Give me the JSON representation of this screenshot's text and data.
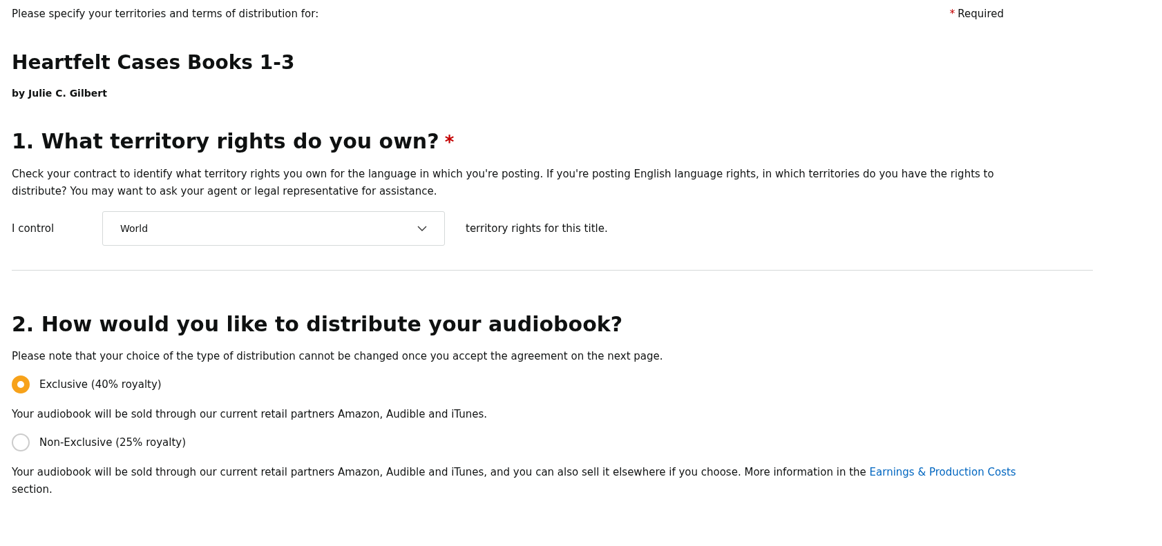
{
  "header": {
    "intro": "Please specify your territories and terms of distribution for:",
    "required_mark": "*",
    "required_label": "Required"
  },
  "book": {
    "title": "Heartfelt Cases Books 1-3",
    "author": "by Julie C. Gilbert"
  },
  "section_1": {
    "heading": "1. What territory rights do you own?",
    "required_mark": "*",
    "description": "Check your contract to identify what territory rights you own for the language in which you're posting. If you're posting English language rights, in which territories do you have the rights to distribute? You may want to ask your agent or legal representative for assistance.",
    "prefix": "I control",
    "select_value": "World",
    "suffix": "territory rights for this title."
  },
  "section_2": {
    "heading": "2. How would you like to distribute your audiobook?",
    "note": "Please note that your choice of the type of distribution cannot be changed once you accept the agreement on the next page.",
    "options": [
      {
        "label": "Exclusive (40% royalty)",
        "selected": true,
        "description": "Your audiobook will be sold through our current retail partners Amazon, Audible and iTunes."
      },
      {
        "label": "Non-Exclusive (25% royalty)",
        "selected": false,
        "description": "Your audiobook will be sold through our current retail partners Amazon, Audible and iTunes, and you can also sell it elsewhere if you choose. More information in the",
        "link": "Earnings & Production Costs",
        "after_link": "section."
      }
    ]
  }
}
